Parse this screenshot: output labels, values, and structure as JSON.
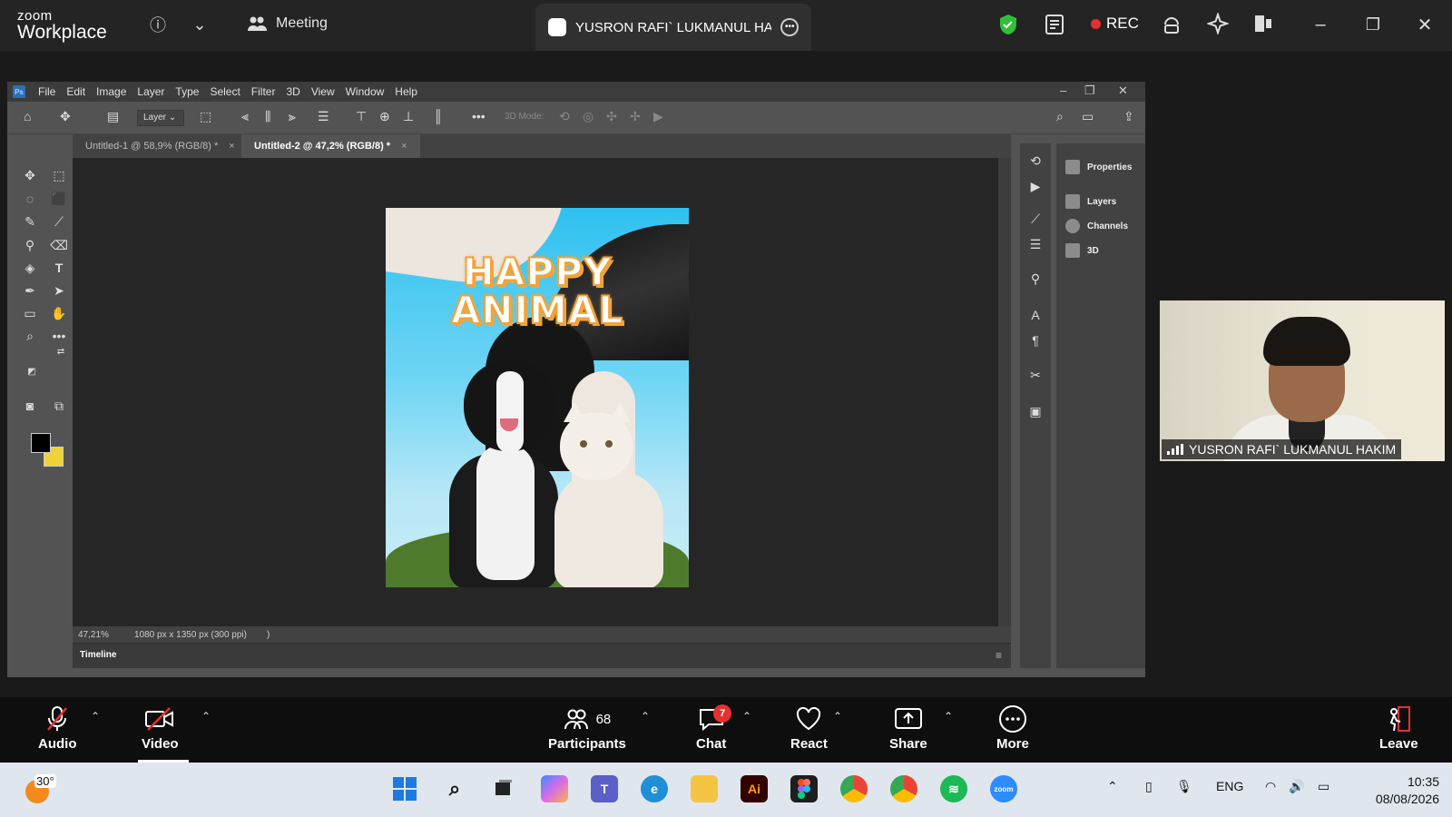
{
  "zoom_top": {
    "brand_small": "zoom",
    "brand_large": "Workplace",
    "meeting_label": "Meeting",
    "participant_name": "YUSRON RAFI` LUKMANUL HAKIM",
    "rec_label": "REC"
  },
  "photoshop": {
    "menu": [
      "File",
      "Edit",
      "Image",
      "Layer",
      "Type",
      "Select",
      "Filter",
      "3D",
      "View",
      "Window",
      "Help"
    ],
    "options": {
      "layer_select": "Layer",
      "mode_3d": "3D Mode:"
    },
    "tabs": [
      {
        "title": "Untitled-1 @ 58,9% (RGB/8) *",
        "close": "×"
      },
      {
        "title": "Untitled-2 @ 47,2% (RGB/8) *",
        "close": "×"
      }
    ],
    "status": {
      "zoom": "47,21%",
      "doc_info": "1080 px x 1350 px (300 ppi)",
      "arrow": ")"
    },
    "timeline_label": "Timeline",
    "panels": [
      "Properties",
      "Layers",
      "Channels",
      "3D"
    ],
    "poster": {
      "line1": "HAPPY",
      "line2": "ANIMAL"
    },
    "swatches": {
      "foreground": "#000000",
      "background": "#eed236"
    }
  },
  "webcam": {
    "name": "YUSRON RAFI` LUKMANUL HAKIM"
  },
  "zoom_bottom": {
    "audio": "Audio",
    "video": "Video",
    "participants": "Participants",
    "participants_count": "68",
    "chat": "Chat",
    "chat_badge": "7",
    "react": "React",
    "share": "Share",
    "more": "More",
    "leave": "Leave"
  },
  "taskbar": {
    "weather_temp": "30°",
    "language": "ENG",
    "time": "10:35",
    "date": "08/08/2026"
  }
}
